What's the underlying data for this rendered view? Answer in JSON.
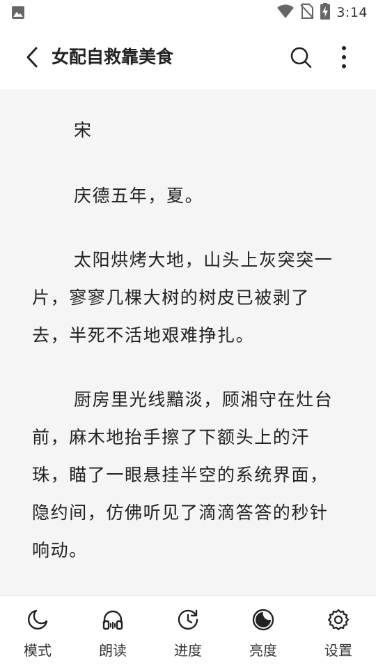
{
  "status_bar": {
    "time": "3:14"
  },
  "app_bar": {
    "title": "女配自救靠美食"
  },
  "content": {
    "paragraphs": [
      "宋",
      "庆德五年，夏。",
      "太阳烘烤大地，山头上灰突突一片，寥寥几棵大树的树皮已被剥了去，半死不活地艰难挣扎。",
      "厨房里光线黯淡，顾湘守在灶台前，麻木地抬手擦了下额头上的汗珠，瞄了一眼悬挂半空的系统界面，隐约间，仿佛听见了滴滴答答的秒针响动。"
    ]
  },
  "bottom_bar": {
    "tabs": [
      {
        "label": "模式",
        "icon": "moon-icon"
      },
      {
        "label": "朗读",
        "icon": "headphones-icon"
      },
      {
        "label": "进度",
        "icon": "progress-clock-icon"
      },
      {
        "label": "亮度",
        "icon": "brightness-icon"
      },
      {
        "label": "设置",
        "icon": "gear-icon"
      }
    ]
  },
  "colors": {
    "reader_bg": "#f5f5f5",
    "bar_bg": "#ffffff",
    "text": "#222222"
  }
}
